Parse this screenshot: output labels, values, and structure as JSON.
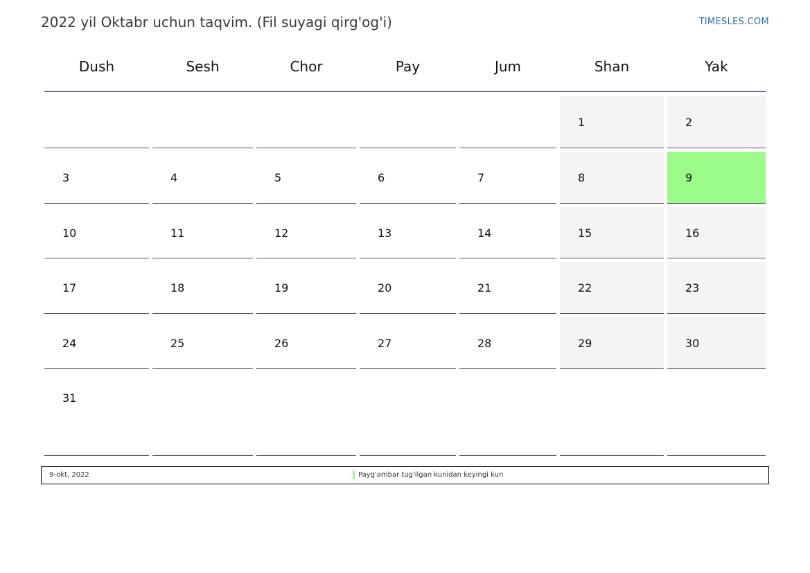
{
  "header": {
    "title": "2022 yil Oktabr uchun taqvim. (Fil suyagi qirg'og'i)",
    "site": "TIMESLES.COM"
  },
  "weekdays": [
    "Dush",
    "Sesh",
    "Chor",
    "Pay",
    "Jum",
    "Shan",
    "Yak"
  ],
  "weeks": [
    [
      "",
      "",
      "",
      "",
      "",
      "1",
      "2"
    ],
    [
      "3",
      "4",
      "5",
      "6",
      "7",
      "8",
      "9"
    ],
    [
      "10",
      "11",
      "12",
      "13",
      "14",
      "15",
      "16"
    ],
    [
      "17",
      "18",
      "19",
      "20",
      "21",
      "22",
      "23"
    ],
    [
      "24",
      "25",
      "26",
      "27",
      "28",
      "29",
      "30"
    ],
    [
      "31",
      "",
      "",
      "",
      "",
      "",
      ""
    ]
  ],
  "holiday_day": "9",
  "colors": {
    "holiday": "#9cfc8a",
    "weekend": "#f4f4f4",
    "header_rule": "#5a7593",
    "link": "#2a6fb0"
  },
  "footer": {
    "date": "9-okt, 2022",
    "event": "Payg'ambar tug'ilgan kunidan keyingi kun"
  }
}
